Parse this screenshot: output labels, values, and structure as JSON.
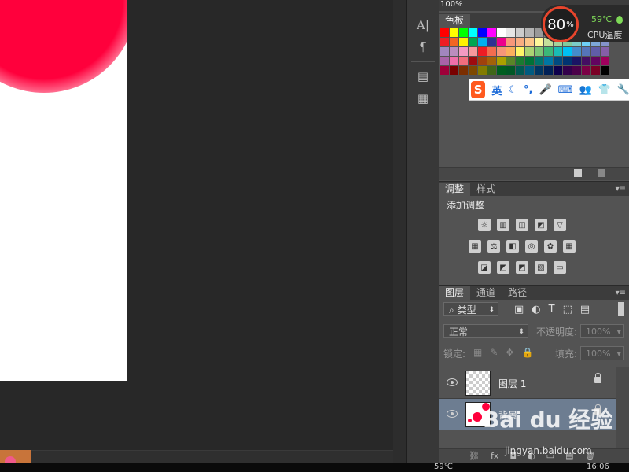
{
  "zoom_label": "100%",
  "swatches_panel": {
    "tab": "色板"
  },
  "swatch_colors": [
    "#ff0000",
    "#ffff00",
    "#00ff00",
    "#00ffff",
    "#0000ff",
    "#ff00ff",
    "#ffffff",
    "#e6e6e6",
    "#cccccc",
    "#b3b3b3",
    "#999999",
    "#808080",
    "#666666",
    "#4d4d4d",
    "#333333",
    "#1a1a1a",
    "#000000",
    "#ffffff",
    "#ee1d24",
    "#f26522",
    "#fff200",
    "#00a651",
    "#00aeef",
    "#2e3192",
    "#ec008c",
    "#f7977a",
    "#f9ad81",
    "#fdc68a",
    "#fff79a",
    "#c4df9b",
    "#a3d39c",
    "#82ca9d",
    "#7bcdc8",
    "#6ecff6",
    "#7ea7d8",
    "#8493ca",
    "#a187be",
    "#bc8dbf",
    "#f49ac2",
    "#f6989d",
    "#ed1c24",
    "#f26c4f",
    "#f69679",
    "#fbaf5d",
    "#fff568",
    "#acd373",
    "#7cc576",
    "#3cb878",
    "#1abbb4",
    "#00bff3",
    "#448ccb",
    "#5574b9",
    "#605ca8",
    "#855fa8",
    "#a864a8",
    "#f06eaa",
    "#f26d7d",
    "#9e0b0f",
    "#a0410d",
    "#a36209",
    "#aba000",
    "#598527",
    "#1a7b30",
    "#007236",
    "#00746b",
    "#0076a3",
    "#004a80",
    "#003471",
    "#1b1464",
    "#440e62",
    "#630460",
    "#9e005d",
    "#9e0039",
    "#790000",
    "#7b2e00",
    "#7d4900",
    "#827b00",
    "#406618",
    "#005e20",
    "#005826",
    "#005952",
    "#005b7f",
    "#003663",
    "#002157",
    "#0d004c",
    "#32004b",
    "#4b0049",
    "#7b0046",
    "#7a0026",
    "#000000"
  ],
  "cpu_widget": {
    "percent": "80",
    "percent_sign": "%",
    "temp": "59℃",
    "label": "CPU温度"
  },
  "ime_bar": {
    "logo": "S",
    "lang": "英",
    "items": [
      "☾",
      "°,",
      "🎤",
      "⌨",
      "👥",
      "👕",
      "🔧"
    ]
  },
  "adjustments_panel": {
    "tabs": [
      "调整",
      "样式"
    ],
    "title": "添加调整",
    "row1": [
      "☼",
      "▥",
      "◫",
      "◩",
      "▽"
    ],
    "row2": [
      "▦",
      "⚖",
      "◧",
      "◎",
      "✿",
      "▦"
    ],
    "row3": [
      "◪",
      "◩",
      "◩",
      "▨",
      "▭"
    ]
  },
  "layers_panel": {
    "tabs": [
      "图层",
      "通道",
      "路径"
    ],
    "filter_label": "类型",
    "blend_mode": "正常",
    "opacity_label": "不透明度:",
    "opacity_value": "100%",
    "lock_label": "锁定:",
    "fill_label": "填充:",
    "fill_value": "100%",
    "layers": [
      {
        "name": "图层 1"
      },
      {
        "name": "背景"
      }
    ]
  },
  "watermark": {
    "text": "Bai du 经验",
    "sub": "jingyan.baidu.com"
  },
  "taskbar": {
    "temp": "59℃",
    "time": "16:06"
  }
}
